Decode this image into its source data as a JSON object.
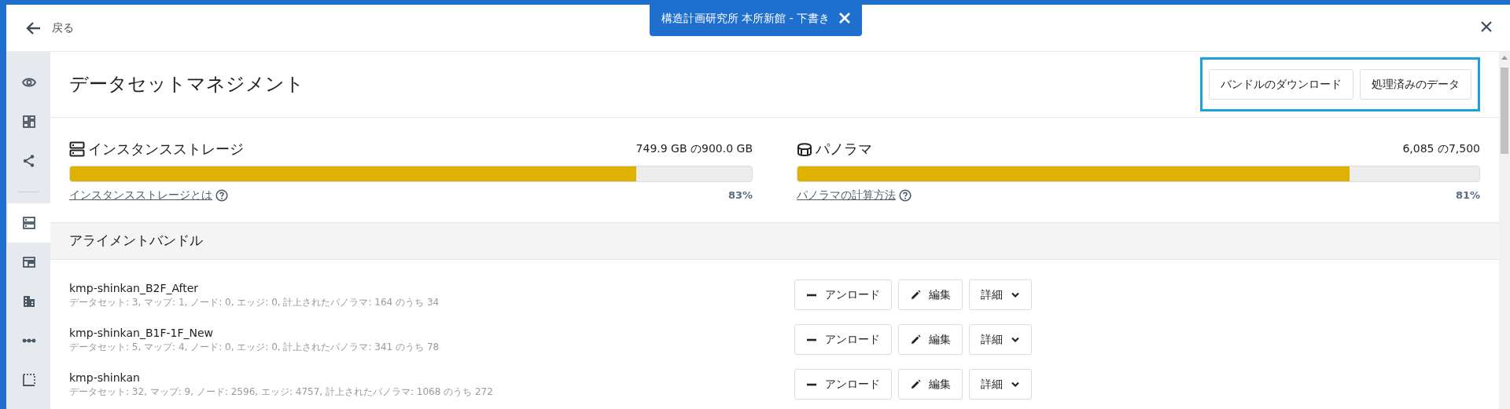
{
  "header": {
    "back_label": "戻る"
  },
  "draft_tab": {
    "title": "構造計画研究所 本所新館 - 下書き"
  },
  "sidebar": {
    "items": [
      {
        "kind": "eye",
        "selected": false
      },
      {
        "kind": "dashboard",
        "selected": false
      },
      {
        "kind": "share",
        "selected": false
      },
      {
        "kind": "divider"
      },
      {
        "kind": "storage",
        "selected": true
      },
      {
        "kind": "layout",
        "selected": false
      },
      {
        "kind": "building",
        "selected": false
      },
      {
        "kind": "nodes",
        "selected": false
      },
      {
        "kind": "area",
        "selected": false
      }
    ]
  },
  "page": {
    "title": "データセットマネジメント",
    "actions": [
      "バンドルのダウンロード",
      "処理済みのデータ"
    ]
  },
  "quotas": [
    {
      "kind": "storage",
      "title": "インスタンスストレージ",
      "usage": "749.9 GB の900.0 GB",
      "level": 0.83,
      "link": "インスタンスストレージとは",
      "percent": "83%"
    },
    {
      "kind": "panorama",
      "title": "パノラマ",
      "usage": "6,085 の7,500",
      "level": 0.81,
      "link": "パノラマの計算方法",
      "percent": "81%"
    }
  ],
  "bundles": {
    "title": "アライメントバンドル",
    "rows": [
      {
        "name": "kmp-shinkan_B2F_After",
        "details": "データセット: 3, マップ: 1, ノード: 0, エッジ: 0, 計上されたパノラマ: 164 のうち 34",
        "buttons": [
          {
            "kind": "unload",
            "label": "アンロード"
          },
          {
            "kind": "edit",
            "label": "編集"
          },
          {
            "kind": "more",
            "label": "詳細"
          }
        ]
      },
      {
        "name": "kmp-shinkan_B1F-1F_New",
        "details": "データセット: 5, マップ: 4, ノード: 0, エッジ: 0, 計上されたパノラマ: 341 のうち 78",
        "buttons": [
          {
            "kind": "unload",
            "label": "アンロード"
          },
          {
            "kind": "edit",
            "label": "編集"
          },
          {
            "kind": "more",
            "label": "詳細"
          }
        ]
      },
      {
        "name": "kmp-shinkan",
        "details": "データセット: 32, マップ: 9, ノード: 2596, エッジ: 4757, 計上されたパノラマ: 1068 のうち 272",
        "buttons": [
          {
            "kind": "unload",
            "label": "アンロード"
          },
          {
            "kind": "edit",
            "label": "編集"
          },
          {
            "kind": "more",
            "label": "詳細"
          }
        ]
      }
    ]
  }
}
